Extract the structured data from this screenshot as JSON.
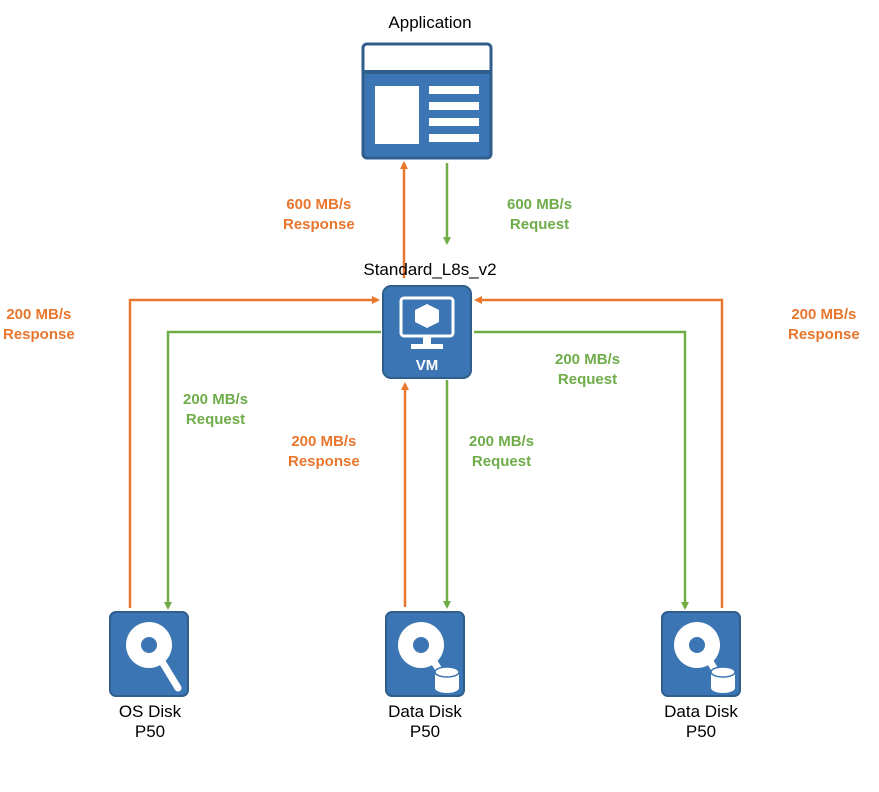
{
  "theme": {
    "response_color": "#e8762d",
    "request_color": "#70ad47",
    "icon_blue": "#3b75b3",
    "icon_blue_dark": "#2f5d8c"
  },
  "application": {
    "title": "Application"
  },
  "vm": {
    "title": "Standard_L8s_v2",
    "caption": "VM"
  },
  "top_flows": {
    "response": {
      "rate": "600 MB/s",
      "kind": "Response"
    },
    "request": {
      "rate": "600 MB/s",
      "kind": "Request"
    }
  },
  "disk_flows": {
    "os_response": {
      "rate": "200 MB/s",
      "kind": "Response"
    },
    "os_request": {
      "rate": "200 MB/s",
      "kind": "Request"
    },
    "data1_response": {
      "rate": "200 MB/s",
      "kind": "Response"
    },
    "data1_request": {
      "rate": "200 MB/s",
      "kind": "Request"
    },
    "data2_response": {
      "rate": "200 MB/s",
      "kind": "Response"
    },
    "data2_request": {
      "rate": "200 MB/s",
      "kind": "Request"
    }
  },
  "disks": {
    "os": {
      "name": "OS Disk",
      "tier": "P50"
    },
    "data1": {
      "name": "Data Disk",
      "tier": "P50"
    },
    "data2": {
      "name": "Data Disk",
      "tier": "P50"
    }
  }
}
